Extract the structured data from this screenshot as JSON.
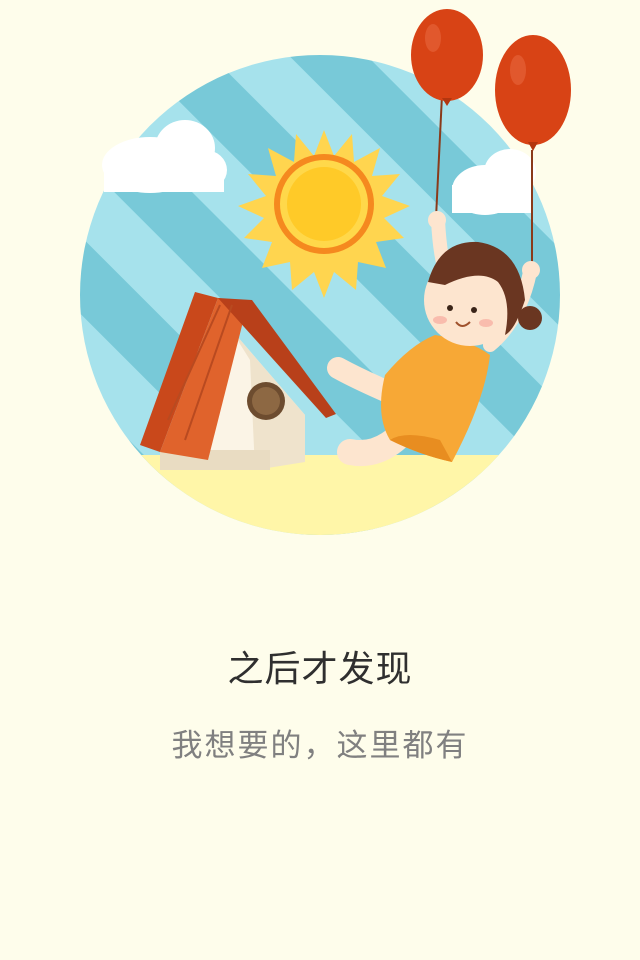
{
  "intro": {
    "title": "之后才发现",
    "subtitle": "我想要的，这里都有"
  },
  "illustration": {
    "icon": "girl-with-balloons-illustration",
    "colors": {
      "background": "#fefdeb",
      "sky": "#78c9d8",
      "sky_stripe": "#a6e2ec",
      "sun": "#ffca28",
      "sun_rays": "#ffd54f",
      "balloon": "#d84315",
      "roof": "#e0632c",
      "ground": "#fff6a8",
      "dress": "#f7a836"
    }
  }
}
